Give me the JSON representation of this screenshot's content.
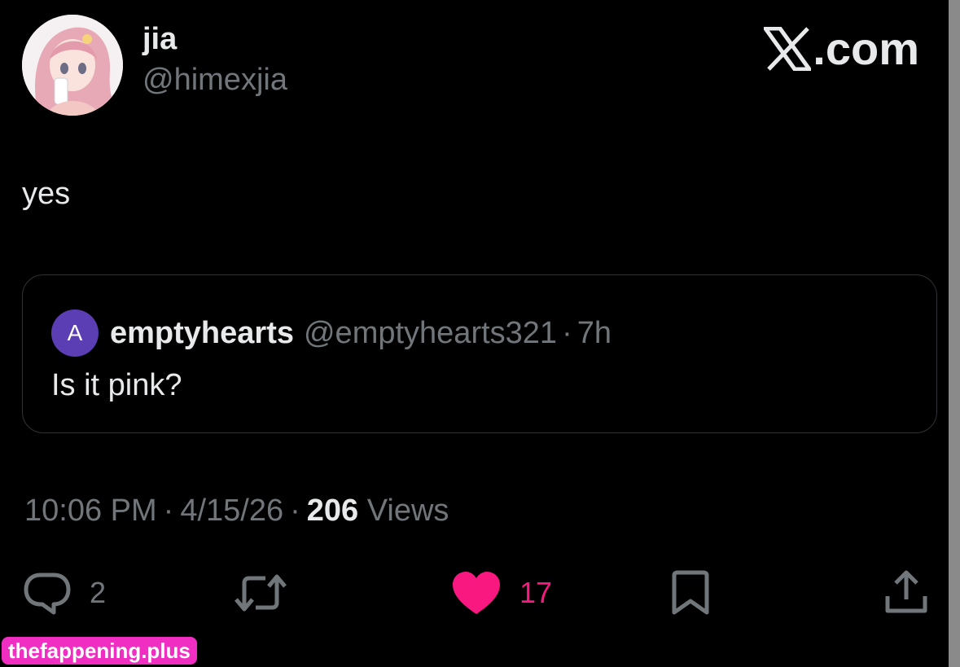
{
  "author": {
    "display_name": "jia",
    "handle": "@himexjia",
    "avatar_icon": "anime-avatar-icon"
  },
  "brand": {
    "suffix": ".com",
    "logo_icon": "x-logo-icon"
  },
  "tweet": {
    "text": "yes"
  },
  "quote": {
    "avatar_letter": "A",
    "avatar_color": "#5b3db4",
    "name": "emptyhearts",
    "handle": "@emptyhearts321",
    "separator": "·",
    "time": "7h",
    "text": "Is it pink?"
  },
  "meta": {
    "time": "10:06 PM",
    "separator": "·",
    "date": "4/15/26",
    "views_count": "206",
    "views_label": "Views"
  },
  "actions": {
    "replies_count": "2",
    "likes_count": "17",
    "like_color": "#f91880"
  },
  "watermark": {
    "text": "thefappening.plus"
  }
}
